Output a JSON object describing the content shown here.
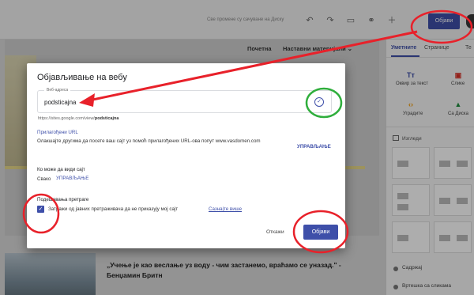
{
  "toolbar": {
    "save_status": "Све промене су сачуване на Диску",
    "publish_label": "Објави",
    "icons": [
      "undo-icon",
      "redo-icon",
      "preview-icon",
      "link-icon",
      "add-person-icon"
    ]
  },
  "site": {
    "nav": [
      "Почетна",
      "Наставни материјали ⌄"
    ],
    "quote": "„Учење је као веслање уз воду - чим застанемо, враћамо се уназад.\" - Бенџамин Бритн"
  },
  "side_panel": {
    "tabs": [
      "Уметните",
      "Странице",
      "Те"
    ],
    "insert_items": [
      {
        "icon": "Tт",
        "label": "Оквир за текст"
      },
      {
        "icon": "▣",
        "label": "Слике"
      },
      {
        "icon": "‹›",
        "label": "Уградите"
      },
      {
        "icon": "▲",
        "label": "Са Диска"
      }
    ],
    "layouts_label": "Изгледи",
    "content_items": [
      "Садржај",
      "Вртешка са сликама"
    ]
  },
  "dialog": {
    "title": "Објављивање на вебу",
    "address_label": "Веб-адреса",
    "address_value": "podsticajna",
    "url_prefix": "https://sites.google.com/view/",
    "url_suffix": "podsticajna",
    "custom_url_title": "Прилагођени URL",
    "custom_url_text": "Олакшајте другима да посете ваш сајт уз помоћ прилагођених URL-ова попут www.vasdomen.com",
    "manage_label": "УПРАВЉАЊЕ",
    "who_title": "Ко може да види сајт",
    "who_value": "Свако",
    "search_title": "Подешавања претраге",
    "search_checkbox": "Затражи од јавних претраживача да не приказују мој сајт",
    "learn_more": "Сазнајте више",
    "cancel_label": "Откажи",
    "publish_label": "Објави"
  },
  "colors": {
    "accent": "#3e4fa9",
    "annotation_red": "#e8212a",
    "annotation_green": "#2fae3c"
  }
}
